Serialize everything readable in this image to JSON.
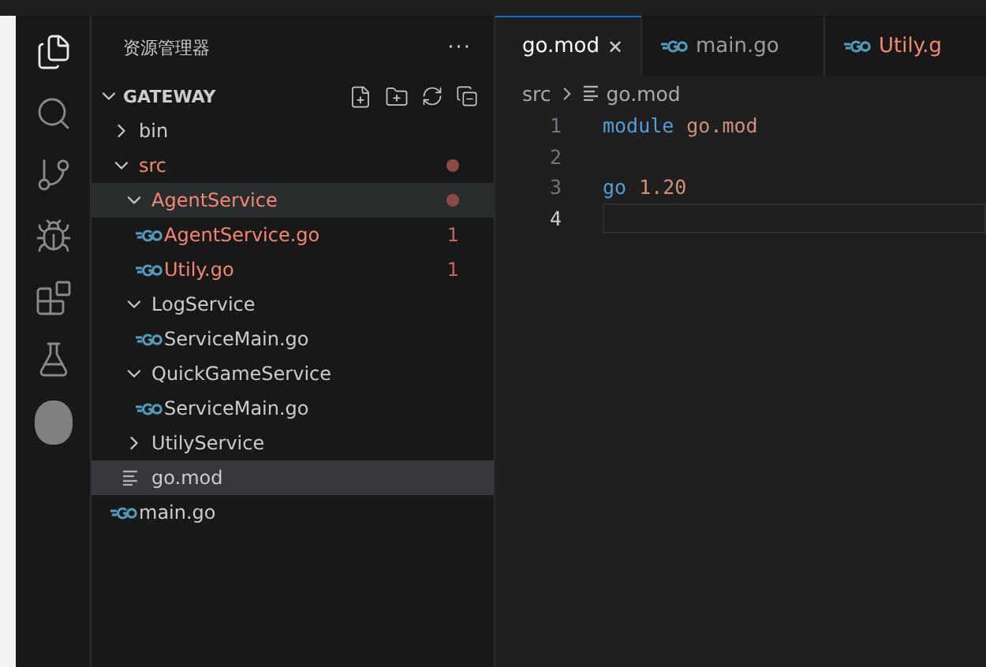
{
  "activity_bar": [
    {
      "kind": "explorer",
      "selected": true
    },
    {
      "kind": "search",
      "selected": false
    },
    {
      "kind": "scm",
      "selected": false
    },
    {
      "kind": "debug",
      "selected": false
    },
    {
      "kind": "extensions",
      "selected": false
    },
    {
      "kind": "testing",
      "selected": false
    },
    {
      "kind": "account",
      "selected": false
    }
  ],
  "sidebar": {
    "title": "资源管理器",
    "more": "···",
    "section": {
      "title": "GATEWAY",
      "expanded": true
    },
    "tree": [
      {
        "label": "bin",
        "kind": "folder",
        "expanded": false,
        "error": false,
        "modified": false,
        "selected": false,
        "highlighted": false
      },
      {
        "label": "src",
        "kind": "folder",
        "expanded": true,
        "error": true,
        "modified": true,
        "selected": false,
        "highlighted": false,
        "children": [
          {
            "label": "AgentService",
            "kind": "folder",
            "expanded": true,
            "error": true,
            "modified": true,
            "selected": false,
            "highlighted": true,
            "children": [
              {
                "label": "AgentService.go",
                "kind": "go",
                "error": true,
                "modified": false,
                "badge": "1",
                "selected": false,
                "highlighted": false
              },
              {
                "label": "Utily.go",
                "kind": "go",
                "error": true,
                "modified": false,
                "badge": "1",
                "selected": false,
                "highlighted": false
              }
            ]
          },
          {
            "label": "LogService",
            "kind": "folder",
            "expanded": true,
            "error": false,
            "modified": false,
            "selected": false,
            "highlighted": false,
            "children": [
              {
                "label": "ServiceMain.go",
                "kind": "go",
                "error": false,
                "modified": false,
                "selected": false,
                "highlighted": false
              }
            ]
          },
          {
            "label": "QuickGameService",
            "kind": "folder",
            "expanded": true,
            "error": false,
            "modified": false,
            "selected": false,
            "highlighted": false,
            "children": [
              {
                "label": "ServiceMain.go",
                "kind": "go",
                "error": false,
                "modified": false,
                "selected": false,
                "highlighted": false
              }
            ]
          },
          {
            "label": "UtilyService",
            "kind": "folder",
            "expanded": false,
            "error": false,
            "modified": false,
            "selected": false,
            "highlighted": false
          },
          {
            "label": "go.mod",
            "kind": "mod",
            "error": false,
            "modified": false,
            "selected": true,
            "highlighted": false
          }
        ]
      },
      {
        "label": "main.go",
        "kind": "go",
        "error": false,
        "modified": false,
        "selected": false,
        "highlighted": false
      }
    ]
  },
  "tabs": [
    {
      "label": "go.mod",
      "kind": "mod",
      "selected": true,
      "error": false,
      "close": "✕"
    },
    {
      "label": "main.go",
      "kind": "go",
      "selected": false,
      "error": false
    },
    {
      "label": "Utily.g",
      "kind": "go",
      "selected": false,
      "error": true
    }
  ],
  "breadcrumb": {
    "folder": "src",
    "file": "go.mod",
    "kind": "mod"
  },
  "code": [
    {
      "number": "1",
      "current": false,
      "tokens": [
        {
          "text": "module",
          "kind": "keyword"
        },
        {
          "text": "go.mod",
          "kind": "value"
        }
      ]
    },
    {
      "number": "2",
      "current": false
    },
    {
      "number": "3",
      "current": false,
      "tokens": [
        {
          "text": "go",
          "kind": "keyword"
        },
        {
          "text": "1.20",
          "kind": "value"
        }
      ]
    },
    {
      "number": "4",
      "current": true
    }
  ]
}
